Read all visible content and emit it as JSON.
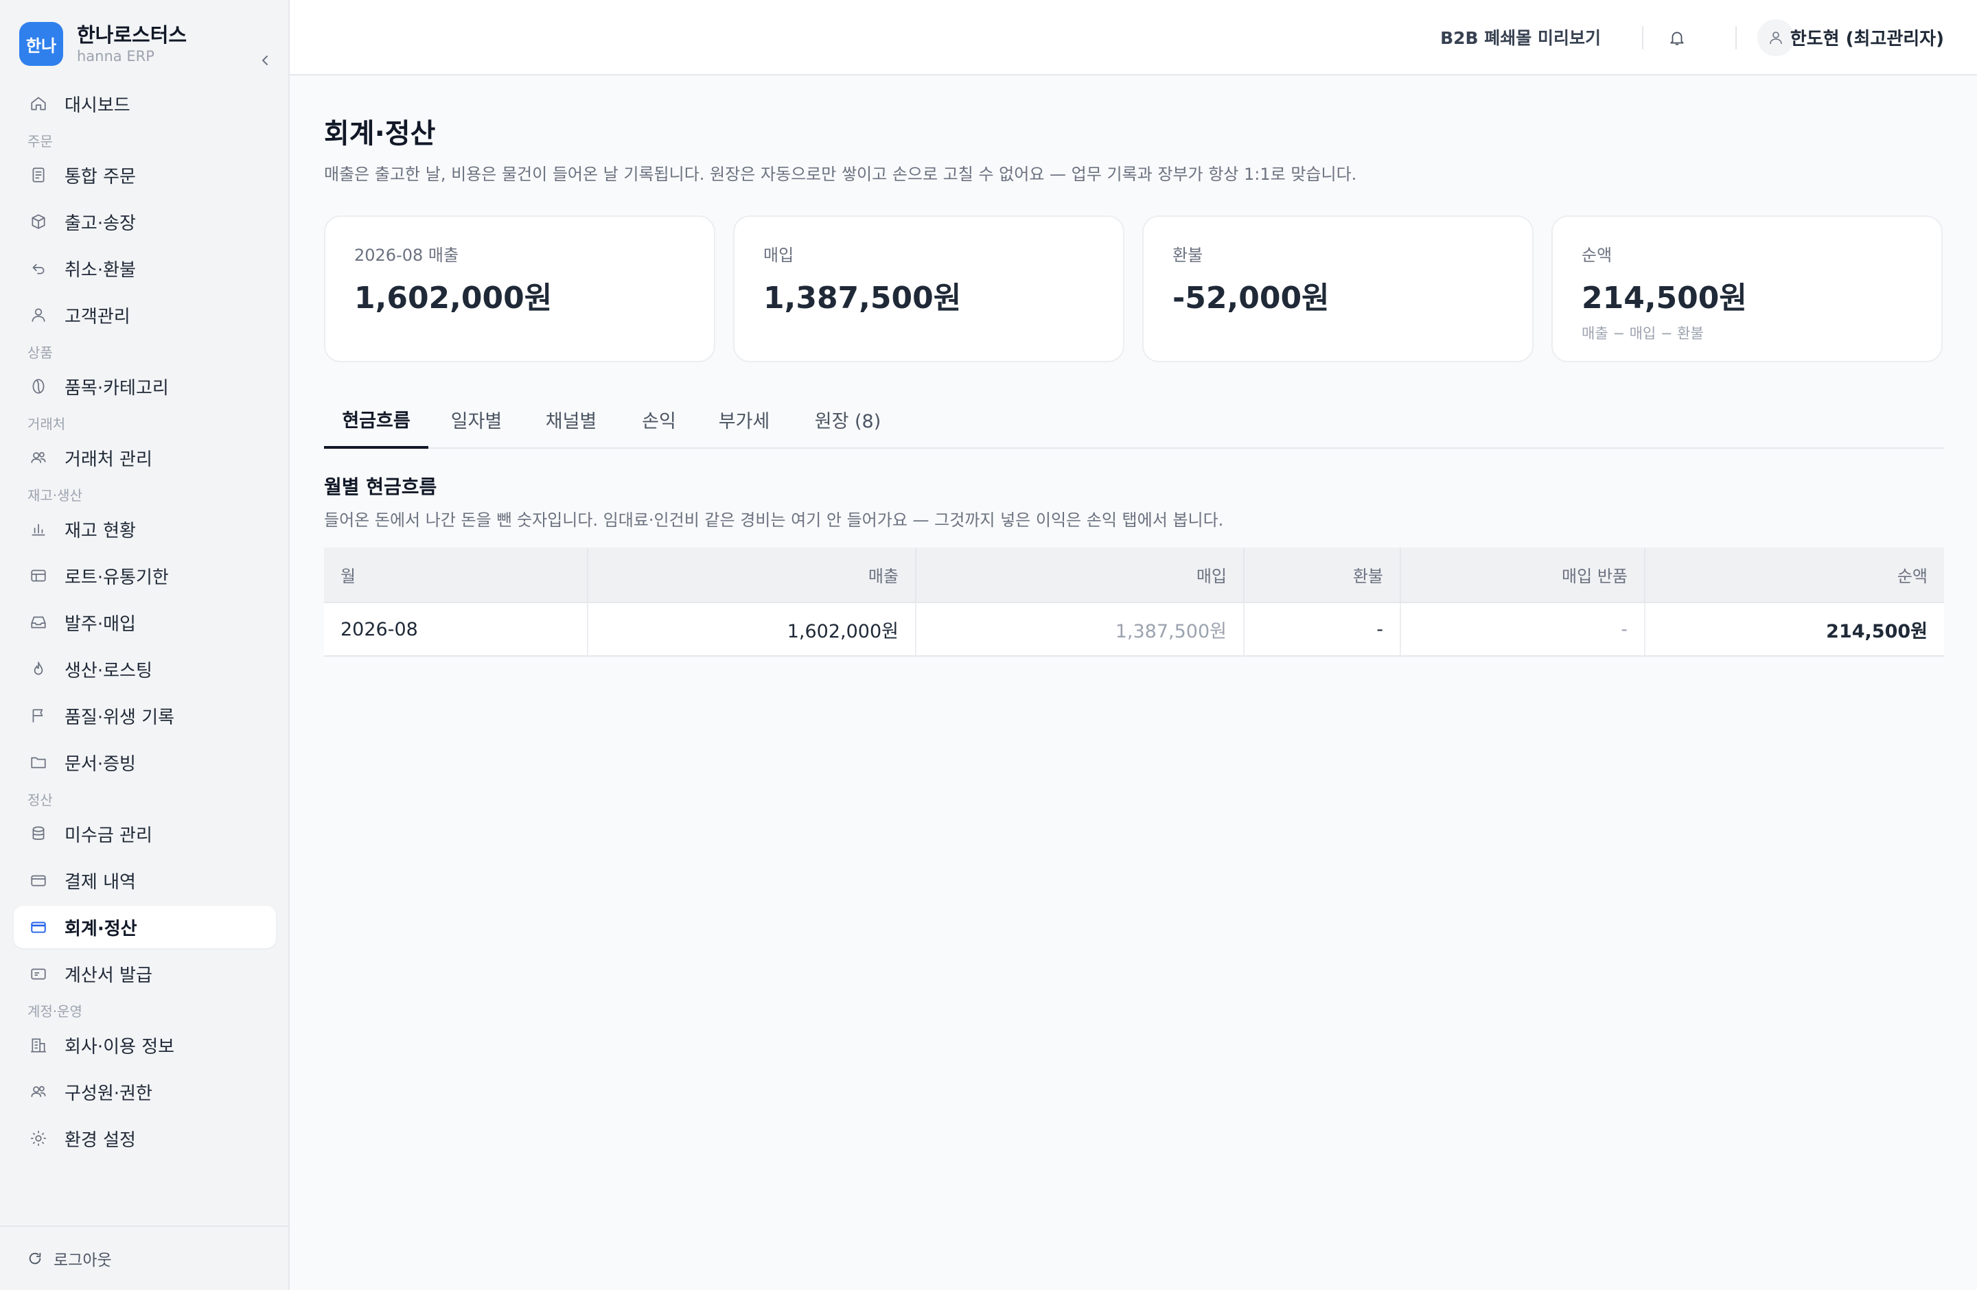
{
  "brand": {
    "logo_text": "한나",
    "name": "한나로스터스",
    "sub": "hanna ERP"
  },
  "sidebar": {
    "dashboard": "대시보드",
    "sections": {
      "order": "주문",
      "product": "상품",
      "partner": "거래처",
      "stock": "재고·생산",
      "settle": "정산",
      "account": "계정·운영"
    },
    "items": {
      "orders": "통합 주문",
      "shipping": "출고·송장",
      "refund": "취소·환불",
      "customers": "고객관리",
      "catalog": "품목·카테고리",
      "partners": "거래처 관리",
      "inventory": "재고 현황",
      "lots": "로트·유통기한",
      "purchase": "발주·매입",
      "roasting": "생산·로스팅",
      "quality": "품질·위생 기록",
      "documents": "문서·증빙",
      "receivables": "미수금 관리",
      "payments": "결제 내역",
      "accounting": "회계·정산",
      "invoices": "계산서 발급",
      "company": "회사·이용 정보",
      "members": "구성원·권한",
      "settings": "환경 설정"
    },
    "logout": "로그아웃"
  },
  "topbar": {
    "preview": "B2B 폐쇄몰 미리보기",
    "user": "한도현 (최고관리자)"
  },
  "page": {
    "title": "회계·정산",
    "desc": "매출은 출고한 날, 비용은 물건이 들어온 날 기록됩니다. 원장은 자동으로만 쌓이고 손으로 고칠 수 없어요 — 업무 기록과 장부가 항상 1:1로 맞습니다."
  },
  "cards": [
    {
      "label": "2026-08 매출",
      "value": "1,602,000원",
      "note": ""
    },
    {
      "label": "매입",
      "value": "1,387,500원",
      "note": ""
    },
    {
      "label": "환불",
      "value": "-52,000원",
      "note": ""
    },
    {
      "label": "순액",
      "value": "214,500원",
      "note": "매출 − 매입 − 환불"
    }
  ],
  "tabs": [
    "현금흐름",
    "일자별",
    "채널별",
    "손익",
    "부가세",
    "원장 (8)"
  ],
  "active_tab": "현금흐름",
  "section": {
    "title": "월별 현금흐름",
    "desc": "들어온 돈에서 나간 돈을 뺀 숫자입니다. 임대료·인건비 같은 경비는 여기 안 들어가요 — 그것까지 넣은 이익은 손익 탭에서 봅니다."
  },
  "table": {
    "headers": [
      "월",
      "매출",
      "매입",
      "환불",
      "매입 반품",
      "순액"
    ],
    "rows": [
      [
        "2026-08",
        "1,602,000원",
        "1,387,500원",
        "-",
        "-",
        "214,500원"
      ]
    ]
  },
  "colors": {
    "accent": "#2f80ed",
    "active_icon": "#2563eb"
  }
}
